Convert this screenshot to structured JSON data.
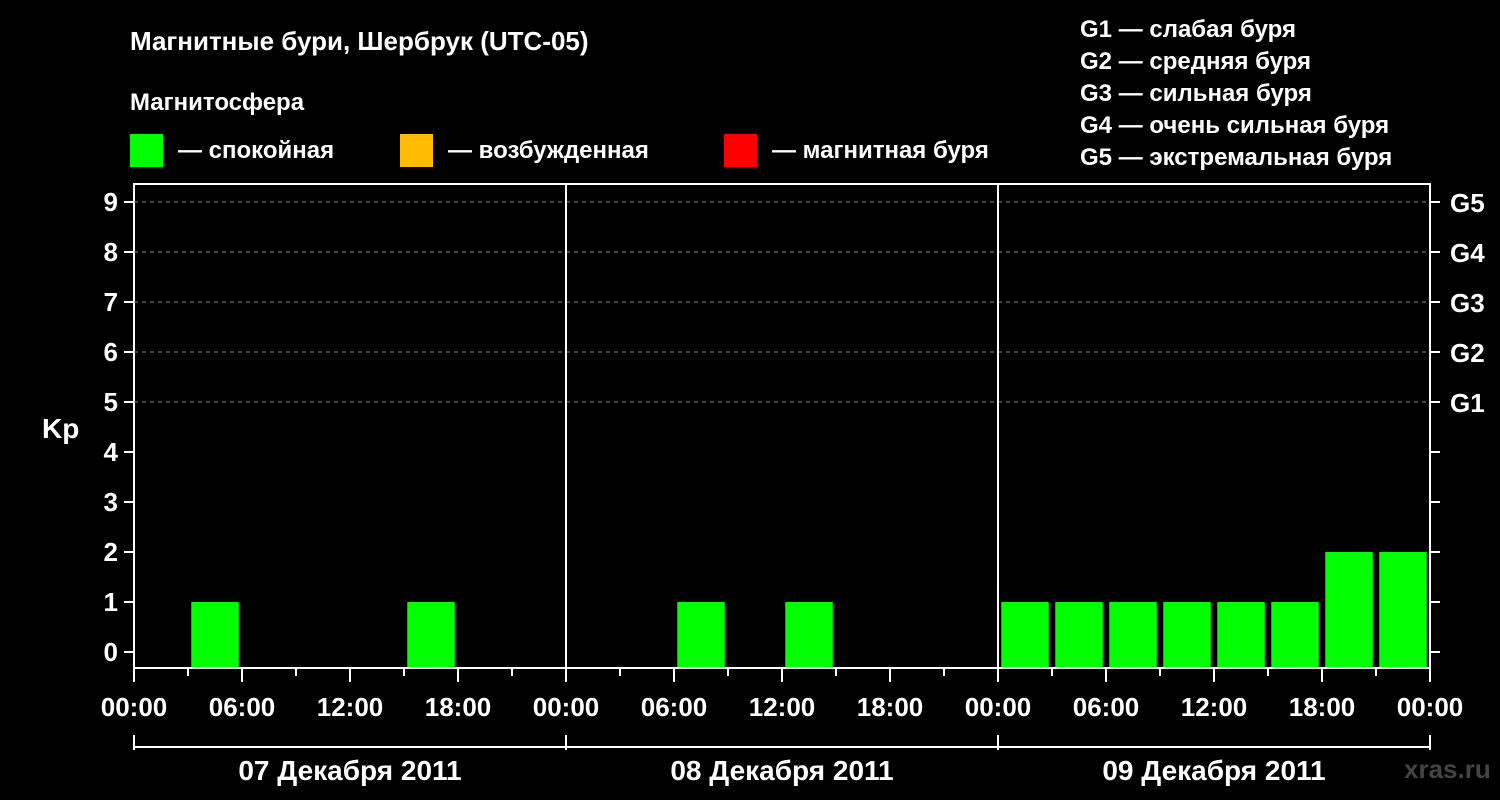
{
  "title": "Магнитные бури, Шербрук (UTC-05)",
  "legend": {
    "heading": "Магнитосфера",
    "items": [
      {
        "color": "#00ff00",
        "label": "— спокойная"
      },
      {
        "color": "#ffbb00",
        "label": "— возбужденная"
      },
      {
        "color": "#ff0000",
        "label": "— магнитная буря"
      }
    ],
    "g_scale": [
      "G1 — слабая буря",
      "G2 — средняя буря",
      "G3 — сильная буря",
      "G4 — очень сильная буря",
      "G5 — экстремальная буря"
    ]
  },
  "watermark": "xras.ru",
  "chart_data": {
    "type": "bar",
    "ylabel": "Kp",
    "ylim": [
      0,
      9
    ],
    "yticks": [
      "0",
      "1",
      "2",
      "3",
      "4",
      "5",
      "6",
      "7",
      "8",
      "9"
    ],
    "right_labels": [
      {
        "kp": 5,
        "label": "G1"
      },
      {
        "kp": 6,
        "label": "G2"
      },
      {
        "kp": 7,
        "label": "G3"
      },
      {
        "kp": 8,
        "label": "G4"
      },
      {
        "kp": 9,
        "label": "G5"
      }
    ],
    "xtick_labels": [
      "00:00",
      "06:00",
      "12:00",
      "18:00",
      "00:00",
      "06:00",
      "12:00",
      "18:00",
      "00:00",
      "06:00",
      "12:00",
      "18:00",
      "00:00"
    ],
    "days": [
      "07 Декабря 2011",
      "08 Декабря 2011",
      "09 Декабря 2011"
    ],
    "bar_interval_hours": 3,
    "series": [
      {
        "values": [
          0,
          1,
          0,
          0,
          0,
          1,
          0,
          0,
          0,
          0,
          1,
          0,
          1,
          0,
          0,
          0,
          1,
          1,
          1,
          1,
          1,
          1,
          2,
          2
        ],
        "colors": [
          "#00ff00",
          "#00ff00",
          "#00ff00",
          "#00ff00",
          "#00ff00",
          "#00ff00",
          "#00ff00",
          "#00ff00",
          "#00ff00",
          "#00ff00",
          "#00ff00",
          "#00ff00",
          "#00ff00",
          "#00ff00",
          "#00ff00",
          "#00ff00",
          "#00ff00",
          "#00ff00",
          "#00ff00",
          "#00ff00",
          "#00ff00",
          "#00ff00",
          "#00ff00",
          "#00ff00"
        ]
      }
    ],
    "grid": true
  }
}
